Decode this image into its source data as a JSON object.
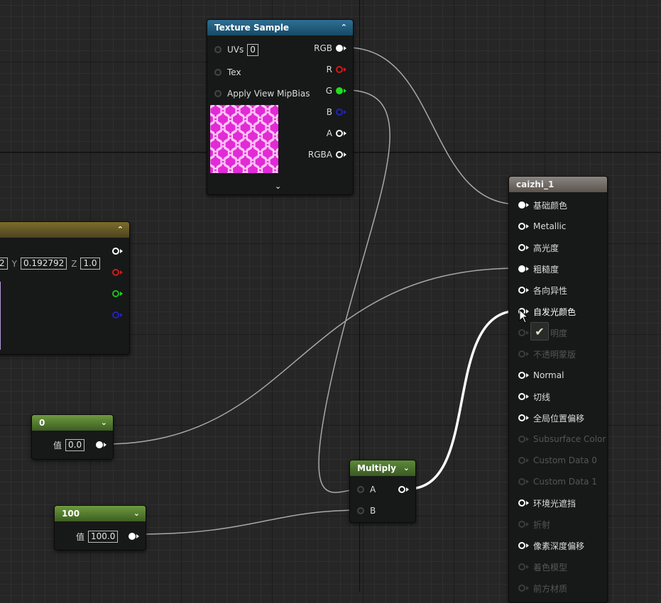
{
  "texture_sample": {
    "title": "Texture Sample",
    "inputs": [
      {
        "label": "UVs",
        "value": "0"
      },
      {
        "label": "Tex"
      },
      {
        "label": "Apply View MipBias"
      }
    ],
    "outputs": [
      "RGB",
      "R",
      "G",
      "B",
      "A",
      "RGBA"
    ]
  },
  "vector_param": {
    "x_value": "2",
    "y_label": "Y",
    "y_value": "0.192792",
    "z_label": "Z",
    "z_value": "1.0"
  },
  "const_0": {
    "title": "0",
    "label": "值",
    "value": "0.0"
  },
  "const_100": {
    "title": "100",
    "label": "值",
    "value": "100.0"
  },
  "multiply": {
    "title": "Multiply",
    "input_a": "A",
    "input_b": "B"
  },
  "material": {
    "title": "caizhi_1",
    "pins": [
      {
        "label": "基础颜色",
        "state": "connected"
      },
      {
        "label": "Metallic",
        "state": "enabled"
      },
      {
        "label": "高光度",
        "state": "enabled"
      },
      {
        "label": "粗糙度",
        "state": "connected"
      },
      {
        "label": "各向异性",
        "state": "enabled"
      },
      {
        "label": "自发光颜色",
        "state": "hover"
      },
      {
        "label": "明度",
        "state": "disabled"
      },
      {
        "label": "不透明蒙版",
        "state": "disabled"
      },
      {
        "label": "Normal",
        "state": "enabled"
      },
      {
        "label": "切线",
        "state": "enabled"
      },
      {
        "label": "全局位置偏移",
        "state": "enabled"
      },
      {
        "label": "Subsurface Color",
        "state": "disabled"
      },
      {
        "label": "Custom Data 0",
        "state": "disabled"
      },
      {
        "label": "Custom Data 1",
        "state": "disabled"
      },
      {
        "label": "环境光遮挡",
        "state": "enabled"
      },
      {
        "label": "折射",
        "state": "disabled"
      },
      {
        "label": "像素深度偏移",
        "state": "enabled"
      },
      {
        "label": "着色模型",
        "state": "disabled"
      },
      {
        "label": "前方材质",
        "state": "disabled"
      }
    ]
  },
  "colors": {
    "grid_bg": "#262626",
    "texture_header": "#2f6f93",
    "multiply_header": "#5d8a3a",
    "wire": "#a8a8a8",
    "active_wire": "#ffffff",
    "texture_preview": "#e030d8"
  }
}
